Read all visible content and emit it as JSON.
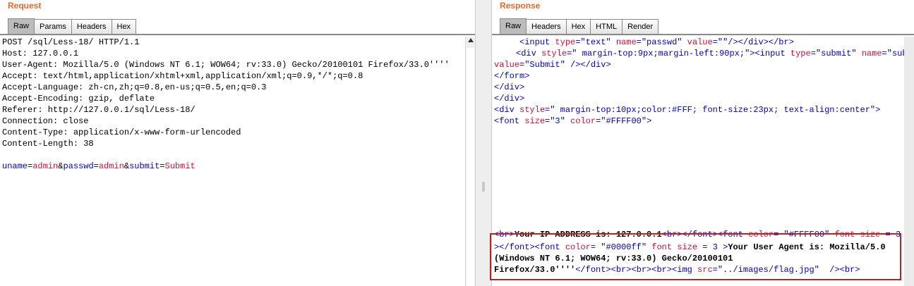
{
  "request": {
    "title": "Request",
    "tabs": [
      "Raw",
      "Params",
      "Headers",
      "Hex"
    ],
    "headers": [
      "POST /sql/Less-18/ HTTP/1.1",
      "Host: 127.0.0.1",
      "User-Agent: Mozilla/5.0 (Windows NT 6.1; WOW64; rv:33.0) Gecko/20100101 Firefox/33.0''''",
      "Accept: text/html,application/xhtml+xml,application/xml;q=0.9,*/*;q=0.8",
      "Accept-Language: zh-cn,zh;q=0.8,en-us;q=0.5,en;q=0.3",
      "Accept-Encoding: gzip, deflate",
      "Referer: http://127.0.0.1/sql/Less-18/",
      "Connection: close",
      "Content-Type: application/x-www-form-urlencoded",
      "Content-Length: 38"
    ],
    "body": {
      "k1": "uname",
      "eq1": "=",
      "v1": "admin",
      "amp1": "&",
      "k2": "passwd",
      "eq2": "=",
      "v2": "admin",
      "amp2": "&",
      "k3": "submit",
      "eq3": "=",
      "v3": "Submit"
    }
  },
  "response": {
    "title": "Response",
    "tabs": [
      "Raw",
      "Headers",
      "Hex",
      "HTML",
      "Render"
    ],
    "l1": {
      "a": "<input ",
      "b": "type",
      "c": "=\"text\" ",
      "d": "name",
      "e": "=\"passwd\" ",
      "f": "value",
      "g": "=\"\"",
      "h": "/></div></br>"
    },
    "l2": {
      "a": "<div ",
      "b": "style",
      "c": "=\" margin-top:9px;margin-left:90px;\">",
      "d": "<input ",
      "e": "type",
      "f": "=\"submit\" ",
      "g": "name",
      "h": "=\"submit\""
    },
    "l3": {
      "a": "value",
      "b": "=\"Submit\" ",
      "c": "/></div>"
    },
    "l4": "</form>",
    "l5": "</div>",
    "l6": "</div>",
    "l7": {
      "a": "<div ",
      "b": "style",
      "c": "=\" margin-top:10px;color:#FFF; font-size:23px; text-align:center\">"
    },
    "l8": {
      "a": "<font ",
      "b": "size",
      "c": "=\"3\" ",
      "d": "color",
      "e": "=\"#FFFF00\">"
    },
    "h1": {
      "a": "<br>",
      "b": "Your IP ADDRESS is: 127.0.0.1",
      "c": "<br></font><font ",
      "d": "color",
      "e": "= \"#FFFF00\" ",
      "f": "font ",
      "g": "size",
      "h": " = 3"
    },
    "h2": {
      "a": "></font><font ",
      "b": "color",
      "c": "= \"#0000ff\" ",
      "d": "font ",
      "e": "size",
      "f": " = 3 ",
      "g": ">",
      "h": "Your User Agent is: Mozilla/5.0"
    },
    "h3": "(Windows NT 6.1; WOW64; rv:33.0) Gecko/20100101",
    "h4": {
      "a": "Firefox/33.0''''",
      "b": "</font><br><br><br><img ",
      "c": "src",
      "d": "=\"../images/flag.jpg\"  ",
      "e": "/><br>"
    }
  }
}
